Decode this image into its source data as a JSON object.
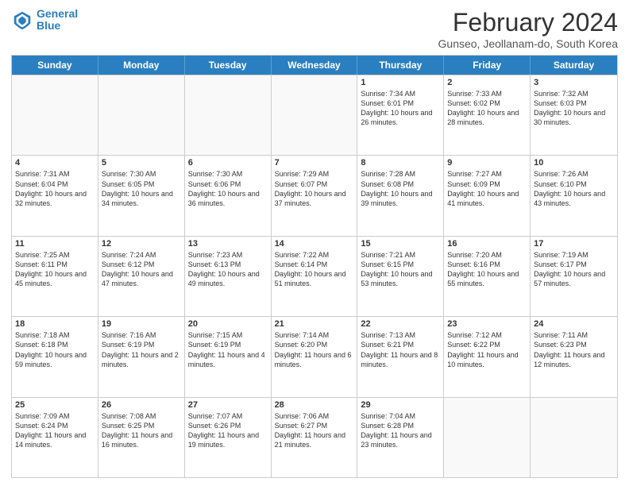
{
  "logo": {
    "line1": "General",
    "line2": "Blue"
  },
  "title": "February 2024",
  "subtitle": "Gunseo, Jeollanam-do, South Korea",
  "headers": [
    "Sunday",
    "Monday",
    "Tuesday",
    "Wednesday",
    "Thursday",
    "Friday",
    "Saturday"
  ],
  "rows": [
    [
      {
        "day": "",
        "text": ""
      },
      {
        "day": "",
        "text": ""
      },
      {
        "day": "",
        "text": ""
      },
      {
        "day": "",
        "text": ""
      },
      {
        "day": "1",
        "text": "Sunrise: 7:34 AM\nSunset: 6:01 PM\nDaylight: 10 hours and 26 minutes."
      },
      {
        "day": "2",
        "text": "Sunrise: 7:33 AM\nSunset: 6:02 PM\nDaylight: 10 hours and 28 minutes."
      },
      {
        "day": "3",
        "text": "Sunrise: 7:32 AM\nSunset: 6:03 PM\nDaylight: 10 hours and 30 minutes."
      }
    ],
    [
      {
        "day": "4",
        "text": "Sunrise: 7:31 AM\nSunset: 6:04 PM\nDaylight: 10 hours and 32 minutes."
      },
      {
        "day": "5",
        "text": "Sunrise: 7:30 AM\nSunset: 6:05 PM\nDaylight: 10 hours and 34 minutes."
      },
      {
        "day": "6",
        "text": "Sunrise: 7:30 AM\nSunset: 6:06 PM\nDaylight: 10 hours and 36 minutes."
      },
      {
        "day": "7",
        "text": "Sunrise: 7:29 AM\nSunset: 6:07 PM\nDaylight: 10 hours and 37 minutes."
      },
      {
        "day": "8",
        "text": "Sunrise: 7:28 AM\nSunset: 6:08 PM\nDaylight: 10 hours and 39 minutes."
      },
      {
        "day": "9",
        "text": "Sunrise: 7:27 AM\nSunset: 6:09 PM\nDaylight: 10 hours and 41 minutes."
      },
      {
        "day": "10",
        "text": "Sunrise: 7:26 AM\nSunset: 6:10 PM\nDaylight: 10 hours and 43 minutes."
      }
    ],
    [
      {
        "day": "11",
        "text": "Sunrise: 7:25 AM\nSunset: 6:11 PM\nDaylight: 10 hours and 45 minutes."
      },
      {
        "day": "12",
        "text": "Sunrise: 7:24 AM\nSunset: 6:12 PM\nDaylight: 10 hours and 47 minutes."
      },
      {
        "day": "13",
        "text": "Sunrise: 7:23 AM\nSunset: 6:13 PM\nDaylight: 10 hours and 49 minutes."
      },
      {
        "day": "14",
        "text": "Sunrise: 7:22 AM\nSunset: 6:14 PM\nDaylight: 10 hours and 51 minutes."
      },
      {
        "day": "15",
        "text": "Sunrise: 7:21 AM\nSunset: 6:15 PM\nDaylight: 10 hours and 53 minutes."
      },
      {
        "day": "16",
        "text": "Sunrise: 7:20 AM\nSunset: 6:16 PM\nDaylight: 10 hours and 55 minutes."
      },
      {
        "day": "17",
        "text": "Sunrise: 7:19 AM\nSunset: 6:17 PM\nDaylight: 10 hours and 57 minutes."
      }
    ],
    [
      {
        "day": "18",
        "text": "Sunrise: 7:18 AM\nSunset: 6:18 PM\nDaylight: 10 hours and 59 minutes."
      },
      {
        "day": "19",
        "text": "Sunrise: 7:16 AM\nSunset: 6:19 PM\nDaylight: 11 hours and 2 minutes."
      },
      {
        "day": "20",
        "text": "Sunrise: 7:15 AM\nSunset: 6:19 PM\nDaylight: 11 hours and 4 minutes."
      },
      {
        "day": "21",
        "text": "Sunrise: 7:14 AM\nSunset: 6:20 PM\nDaylight: 11 hours and 6 minutes."
      },
      {
        "day": "22",
        "text": "Sunrise: 7:13 AM\nSunset: 6:21 PM\nDaylight: 11 hours and 8 minutes."
      },
      {
        "day": "23",
        "text": "Sunrise: 7:12 AM\nSunset: 6:22 PM\nDaylight: 11 hours and 10 minutes."
      },
      {
        "day": "24",
        "text": "Sunrise: 7:11 AM\nSunset: 6:23 PM\nDaylight: 11 hours and 12 minutes."
      }
    ],
    [
      {
        "day": "25",
        "text": "Sunrise: 7:09 AM\nSunset: 6:24 PM\nDaylight: 11 hours and 14 minutes."
      },
      {
        "day": "26",
        "text": "Sunrise: 7:08 AM\nSunset: 6:25 PM\nDaylight: 11 hours and 16 minutes."
      },
      {
        "day": "27",
        "text": "Sunrise: 7:07 AM\nSunset: 6:26 PM\nDaylight: 11 hours and 19 minutes."
      },
      {
        "day": "28",
        "text": "Sunrise: 7:06 AM\nSunset: 6:27 PM\nDaylight: 11 hours and 21 minutes."
      },
      {
        "day": "29",
        "text": "Sunrise: 7:04 AM\nSunset: 6:28 PM\nDaylight: 11 hours and 23 minutes."
      },
      {
        "day": "",
        "text": ""
      },
      {
        "day": "",
        "text": ""
      }
    ]
  ]
}
